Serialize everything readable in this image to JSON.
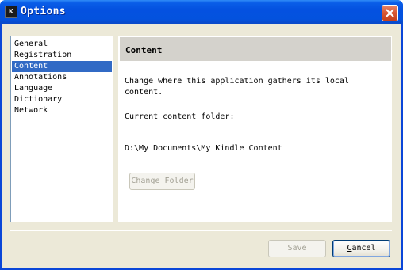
{
  "window": {
    "title": "Options",
    "icon_label": "K"
  },
  "sidebar": {
    "items": [
      {
        "label": "General",
        "selected": false
      },
      {
        "label": "Registration",
        "selected": false
      },
      {
        "label": "Content",
        "selected": true
      },
      {
        "label": "Annotations",
        "selected": false
      },
      {
        "label": "Language",
        "selected": false
      },
      {
        "label": "Dictionary",
        "selected": false
      },
      {
        "label": "Network",
        "selected": false
      }
    ]
  },
  "content": {
    "header": "Content",
    "description_line1": "Change where this application gathers its local",
    "description_line2": "content.",
    "current_folder_label": "Current content folder:",
    "current_folder_path": "D:\\My Documents\\My Kindle Content",
    "change_folder_button": "Change Folder"
  },
  "footer": {
    "save_label": "Save",
    "cancel_mnemonic": "C",
    "cancel_rest": "ancel"
  },
  "colors": {
    "title_bar": "#0451e0",
    "selection": "#316ac5",
    "dialog_bg": "#ece9d8",
    "header_bg": "#d4d2cc"
  }
}
